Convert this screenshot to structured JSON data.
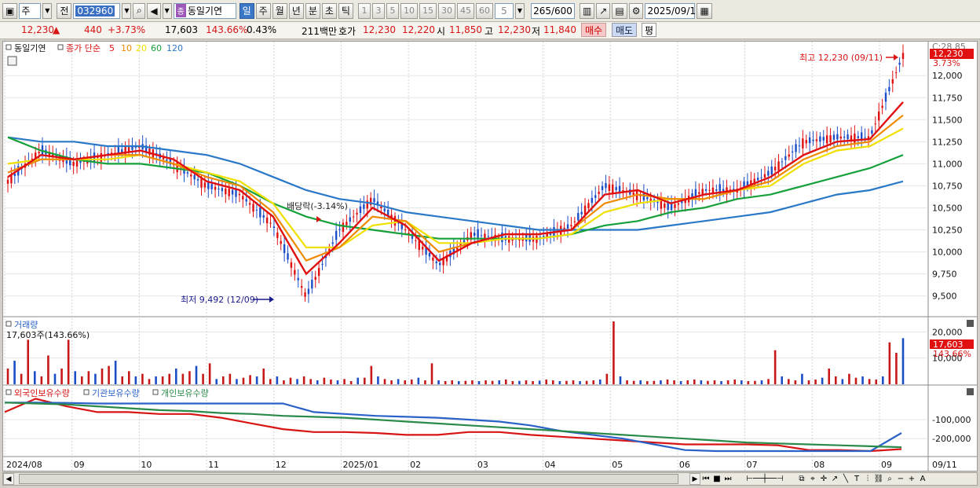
{
  "toolbar": {
    "market_select": "주",
    "prev_label": "전",
    "stock_code": "032960",
    "category_tag": "종",
    "stock_name": "동일기연",
    "period_buttons": [
      "일",
      "주",
      "월",
      "년",
      "분",
      "초",
      "틱"
    ],
    "selected_period": "일",
    "interval_buttons": [
      "1",
      "3",
      "5",
      "10",
      "15",
      "30",
      "45",
      "60"
    ],
    "interval_custom": "5",
    "count_display": "265/600",
    "date": "2025/09/11"
  },
  "quote": {
    "price": "12,230",
    "change_arrow": "▲",
    "change": "440",
    "change_pct": "+3.73%",
    "volume": "17,603",
    "volume_ratio": "143.66%",
    "turnover": "0.43%",
    "amount": "211백만",
    "ask_label": "호가",
    "ask": "12,230",
    "bid": "12,220",
    "open_label": "시",
    "open": "11,850",
    "high_label": "고",
    "high": "12,230",
    "low_label": "저",
    "low": "11,840",
    "buy_button": "매수",
    "sell_button": "매도",
    "avg_button": "평"
  },
  "price_pane": {
    "legend_name": "동일기연",
    "legend_ma_title": "종가 단순",
    "legend_ma": [
      {
        "period": "5",
        "color": "#e01010"
      },
      {
        "period": "10",
        "color": "#f08a00"
      },
      {
        "period": "20",
        "color": "#f0e000"
      },
      {
        "period": "60",
        "color": "#16a03a"
      },
      {
        "period": "120",
        "color": "#2a78c8"
      }
    ],
    "corner_text": "C:28.85",
    "last_price_badge": "12,230",
    "last_pct_label": "3.73%",
    "high_annotation": "최고 12,230 (09/11)",
    "low_annotation": "최저 9,492 (12/09)",
    "dividend_annotation": "배당락(-3.14%)"
  },
  "volume_pane": {
    "title": "거래량",
    "value_label": "17,603주(143.66%)",
    "last_badge": "17,603",
    "last_pct": "143.66%"
  },
  "holdings_pane": {
    "legend": [
      {
        "name": "외국인보유수량",
        "color": "#d81414"
      },
      {
        "name": "기관보유수량",
        "color": "#2a62c8"
      },
      {
        "name": "개인보유수량",
        "color": "#2a8a4a"
      }
    ]
  },
  "x_axis_labels": [
    "2024/08",
    "09",
    "10",
    "11",
    "12",
    "2025/01",
    "02",
    "03",
    "04",
    "05",
    "06",
    "07",
    "08",
    "09"
  ],
  "x_axis_last": "09/11",
  "chart_data": [
    {
      "type": "line",
      "title": "동일기연",
      "ylim": [
        9300,
        12350
      ],
      "y_ticks": [
        9500,
        9750,
        10000,
        10250,
        10500,
        10750,
        11000,
        11250,
        11500,
        11750,
        12000
      ],
      "y_tick_labels": [
        "9,500",
        "9,750",
        "10,000",
        "10,250",
        "10,500",
        "10,750",
        "11,000",
        "11,250",
        "11,500",
        "11,750",
        "12,000"
      ],
      "x": [
        "2024/08",
        "2024/08",
        "2024/09",
        "2024/09",
        "2024/10",
        "2024/10",
        "2024/11",
        "2024/11",
        "2024/12",
        "2024/12",
        "2025/01",
        "2025/01",
        "2025/02",
        "2025/02",
        "2025/03",
        "2025/03",
        "2025/04",
        "2025/04",
        "2025/05",
        "2025/05",
        "2025/06",
        "2025/06",
        "2025/07",
        "2025/07",
        "2025/08",
        "2025/08",
        "2025/09",
        "2025/09"
      ],
      "series": [
        {
          "name": "5",
          "color": "#e01010",
          "values": [
            10850,
            11100,
            11050,
            11100,
            11150,
            11050,
            10800,
            10700,
            10400,
            9750,
            10100,
            10500,
            10300,
            9900,
            10100,
            10200,
            10200,
            10250,
            10650,
            10700,
            10550,
            10650,
            10700,
            10850,
            11100,
            11250,
            11280,
            11700
          ]
        },
        {
          "name": "10",
          "color": "#f08a00",
          "values": [
            10900,
            11050,
            11050,
            11100,
            11100,
            11000,
            10850,
            10750,
            10450,
            9900,
            10050,
            10400,
            10350,
            10000,
            10100,
            10200,
            10200,
            10250,
            10550,
            10650,
            10600,
            10600,
            10700,
            10800,
            11050,
            11200,
            11250,
            11550
          ]
        },
        {
          "name": "20",
          "color": "#f0e000",
          "values": [
            11000,
            11050,
            11050,
            11050,
            11100,
            11000,
            10900,
            10800,
            10550,
            10050,
            10050,
            10300,
            10350,
            10100,
            10100,
            10150,
            10150,
            10200,
            10450,
            10550,
            10600,
            10600,
            10700,
            10750,
            11000,
            11150,
            11200,
            11400
          ]
        },
        {
          "name": "60",
          "color": "#16a03a",
          "values": [
            11300,
            11150,
            11050,
            11000,
            11000,
            10950,
            10900,
            10750,
            10550,
            10400,
            10300,
            10250,
            10200,
            10150,
            10150,
            10150,
            10150,
            10200,
            10300,
            10350,
            10450,
            10500,
            10600,
            10650,
            10750,
            10850,
            10950,
            11100
          ]
        },
        {
          "name": "120",
          "color": "#2a78c8",
          "values": [
            11300,
            11250,
            11250,
            11200,
            11200,
            11150,
            11100,
            11000,
            10850,
            10700,
            10600,
            10550,
            10450,
            10400,
            10350,
            10300,
            10250,
            10250,
            10250,
            10250,
            10300,
            10350,
            10400,
            10450,
            10550,
            10650,
            10700,
            10800
          ]
        },
        {
          "name": "close",
          "color": "#d81414",
          "values": [
            10800,
            11150,
            11000,
            11100,
            11200,
            11000,
            10750,
            10650,
            10300,
            9492,
            10250,
            10600,
            10250,
            9850,
            10200,
            10150,
            10150,
            10300,
            10750,
            10650,
            10500,
            10700,
            10700,
            10900,
            11250,
            11300,
            11300,
            12230
          ]
        }
      ]
    },
    {
      "type": "bar",
      "title": "거래량",
      "ylim": [
        0,
        24000
      ],
      "y_ticks": [
        10000,
        20000
      ],
      "y_tick_labels": [
        "10,000",
        "20,000"
      ],
      "values": [
        6000,
        9000,
        4000,
        17000,
        5000,
        3000,
        11000,
        4000,
        6000,
        17000,
        5000,
        3000,
        5000,
        4000,
        6000,
        7000,
        9000,
        3000,
        5000,
        3000,
        4000,
        2000,
        3000,
        3000,
        4000,
        6000,
        4000,
        5000,
        7000,
        4000,
        8000,
        2000,
        3000,
        4000,
        2000,
        2500,
        3500,
        3000,
        6000,
        2000,
        3000,
        1500,
        2500,
        2000,
        3000,
        2000,
        1500,
        2500,
        1800,
        1500,
        2000,
        1200,
        2500,
        2500,
        7000,
        3000,
        2000,
        1500,
        2000,
        1500,
        1800,
        2500,
        1500,
        8000,
        1500,
        1200,
        1500,
        1200,
        1300,
        1500,
        1200,
        1500,
        1300,
        1500,
        1800,
        1200,
        1300,
        1500,
        1200,
        1400,
        1800,
        1500,
        1200,
        1300,
        1500,
        1200,
        1300,
        1500,
        1800,
        4000,
        25000,
        3000,
        1500,
        1300,
        1500,
        1200,
        1300,
        1500,
        1800,
        1500,
        1200,
        1500,
        1800,
        1500,
        1300,
        1500,
        1200,
        1500,
        1800,
        1500,
        1200,
        1300,
        1500,
        2000,
        13000,
        3000,
        2000,
        1500,
        4000,
        1500,
        1800,
        2500,
        6000,
        3000,
        2000,
        4000,
        2500,
        3000,
        2000,
        1800,
        3000,
        16000,
        12000,
        17603
      ]
    },
    {
      "type": "line",
      "title": "보유수량",
      "ylim": [
        -290000,
        20000
      ],
      "y_ticks": [
        -100000,
        -200000
      ],
      "y_tick_labels": [
        "-100,000",
        "-200,000"
      ],
      "series": [
        {
          "name": "외국인보유수량",
          "color": "#d81414",
          "values": [
            -60000,
            10000,
            -30000,
            -60000,
            -60000,
            -70000,
            -70000,
            -90000,
            -120000,
            -150000,
            -165000,
            -165000,
            -170000,
            -180000,
            -180000,
            -165000,
            -165000,
            -180000,
            -190000,
            -200000,
            -210000,
            -220000,
            -230000,
            -230000,
            -230000,
            -235000,
            -260000,
            -260000,
            -265000,
            -255000
          ]
        },
        {
          "name": "기관보유수량",
          "color": "#2a62c8",
          "values": [
            -10000,
            -10000,
            -12000,
            -15000,
            -15000,
            -15000,
            -15000,
            -15000,
            -15000,
            -15000,
            -60000,
            -70000,
            -80000,
            -85000,
            -90000,
            -100000,
            -110000,
            -130000,
            -160000,
            -180000,
            -200000,
            -230000,
            -260000,
            -265000,
            -265000,
            -265000,
            -265000,
            -265000,
            -265000,
            -170000
          ]
        },
        {
          "name": "개인보유수량",
          "color": "#2a8a4a",
          "values": [
            -10000,
            -15000,
            -20000,
            -30000,
            -40000,
            -50000,
            -55000,
            -65000,
            -70000,
            -80000,
            -85000,
            -90000,
            -100000,
            -110000,
            -120000,
            -130000,
            -140000,
            -150000,
            -160000,
            -170000,
            -180000,
            -190000,
            -200000,
            -210000,
            -220000,
            -225000,
            -230000,
            -235000,
            -240000,
            -245000
          ]
        }
      ]
    }
  ]
}
